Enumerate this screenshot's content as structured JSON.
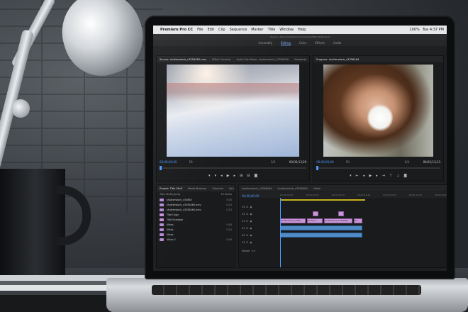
{
  "menubar": {
    "apple_icon": "",
    "app_name": "Premiere Pro CC",
    "menus": [
      "File",
      "Edit",
      "Clip",
      "Sequence",
      "Marker",
      "Title",
      "Window",
      "Help"
    ],
    "battery": "100%",
    "clock": "Tue 4:37 PM"
  },
  "window": {
    "path": "/Users/…/Documents/Premiere Projects/Title Stuff.prproj"
  },
  "workspaces": [
    "Assembly",
    "Editing",
    "Color",
    "Effects",
    "Audio"
  ],
  "source_monitor": {
    "tabs": [
      "Source: shutterstock_v3356460.mov",
      "Effect Controls",
      "Audio Clip Mixer: shutterstock_v3356460",
      "Metadata"
    ],
    "timecode": "00;00;00;00",
    "fit": "Fit",
    "ratio": "1/2",
    "duration": "00;00;13;29"
  },
  "program_monitor": {
    "tabs": [
      "Program: shutterstock_v3356464"
    ],
    "timecode": "00;00;00;00",
    "fit": "Fit",
    "ratio": "1/4",
    "duration": "00;01;13;13"
  },
  "project_panel": {
    "tabs": [
      "Project: Title Stuff",
      "Media Browser",
      "Libraries",
      "Info"
    ],
    "folder": "Title Stuff.prproj",
    "items_count": "13 Items",
    "items": [
      {
        "name": "shutterstock_v33885",
        "dur": "0;00",
        "color": "#b38bd6"
      },
      {
        "name": "shutterstock_v3356460.mov",
        "dur": "0;13",
        "color": "#b38bd6"
      },
      {
        "name": "shutterstock_v3356464.mov",
        "dur": "0;13",
        "color": "#b38bd6"
      },
      {
        "name": "Title Copy",
        "dur": "",
        "color": "#c990d9"
      },
      {
        "name": "Title Example",
        "dur": "",
        "color": "#c990d9"
      },
      {
        "name": "Video",
        "dur": "0;00",
        "color": "#b38bd6"
      },
      {
        "name": "Video",
        "dur": "0;15",
        "color": "#b38bd6"
      },
      {
        "name": "Video",
        "dur": "",
        "color": "#b38bd6"
      },
      {
        "name": "Video 2",
        "dur": "0;00",
        "color": "#b38bd6"
      }
    ]
  },
  "timeline": {
    "tabs": [
      "shutterstock_v3356464",
      "shutterstock_v3356460",
      "Video"
    ],
    "timecode": "00;00;00;00",
    "ruler": [
      "00;00;00;00",
      "00;00;04;29",
      "00;00;09;29",
      "00;00;14;29",
      "00;00;19;29",
      "00;00;24;29",
      "00;00;29;29",
      "00;00;34;28"
    ],
    "tracks": [
      "V3",
      "V2",
      "V1",
      "A1",
      "A2",
      "A3"
    ],
    "clips": [
      "shutterstock_v3356…",
      "shutters…",
      "shutterstock_v3356464",
      "sh…"
    ],
    "master": "Master",
    "master_level": "0.0"
  }
}
